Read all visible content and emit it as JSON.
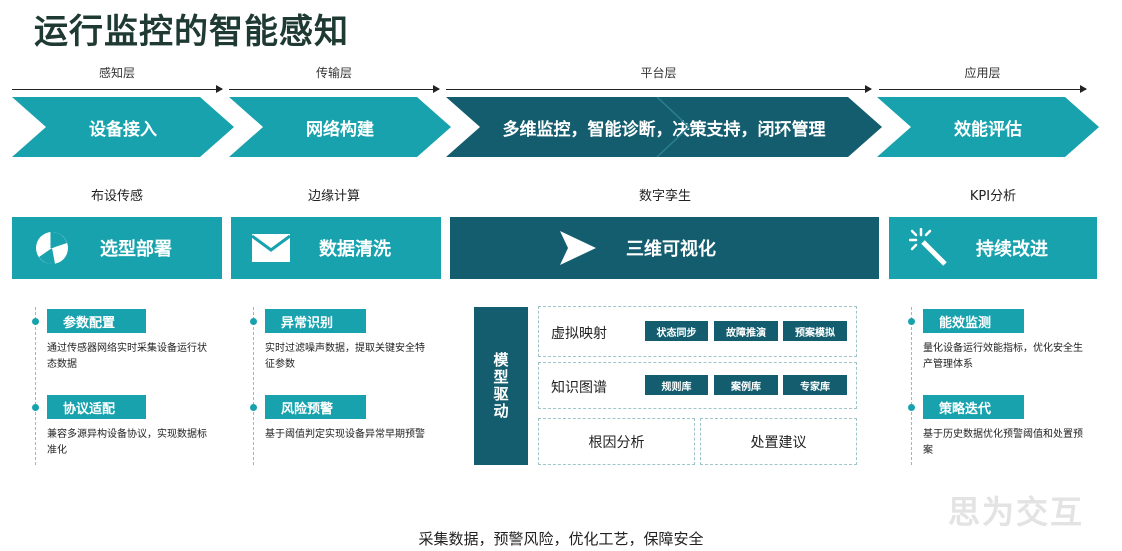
{
  "title": "运行监控的智能感知",
  "layers": [
    "感知层",
    "传输层",
    "平台层",
    "应用层"
  ],
  "chevrons": [
    "设备接入",
    "网络构建",
    "多维监控，智能诊断，决策支持，闭环管理",
    "效能评估"
  ],
  "captions": [
    "布设传感",
    "边缘计算",
    "数字孪生",
    "KPI分析"
  ],
  "boxes": [
    {
      "label": "选型部署",
      "icon": "pie-chart-icon"
    },
    {
      "label": "数据清洗",
      "icon": "envelope-icon"
    },
    {
      "label": "三维可视化",
      "icon": "send-arrow-icon"
    },
    {
      "label": "持续改进",
      "icon": "magic-wand-icon"
    }
  ],
  "col1": [
    {
      "tag": "参数配置",
      "desc": "通过传感器网络实时采集设备运行状态数据"
    },
    {
      "tag": "协议适配",
      "desc": "兼容多源异构设备协议，实现数据标准化"
    }
  ],
  "col2": [
    {
      "tag": "异常识别",
      "desc": "实时过滤噪声数据，提取关键安全特征参数"
    },
    {
      "tag": "风险预警",
      "desc": "基于阈值判定实现设备异常早期预警"
    }
  ],
  "col4": [
    {
      "tag": "能效监测",
      "desc": "量化设备运行效能指标，优化安全生产管理体系"
    },
    {
      "tag": "策略迭代",
      "desc": "基于历史数据优化预警阈值和处置预案"
    }
  ],
  "center": {
    "model": "模型驱动",
    "row1": {
      "label": "虚拟映射",
      "chips": [
        "状态同步",
        "故障推演",
        "预案模拟"
      ]
    },
    "row2": {
      "label": "知识图谱",
      "chips": [
        "规则库",
        "案例库",
        "专家库"
      ]
    },
    "row3": [
      "根因分析",
      "处置建议"
    ]
  },
  "footer": "采集数据，预警风险，优化工艺，保障安全",
  "watermark": "思为交互",
  "colors": {
    "teal": "#17a2ad",
    "dark": "#135d6e"
  }
}
